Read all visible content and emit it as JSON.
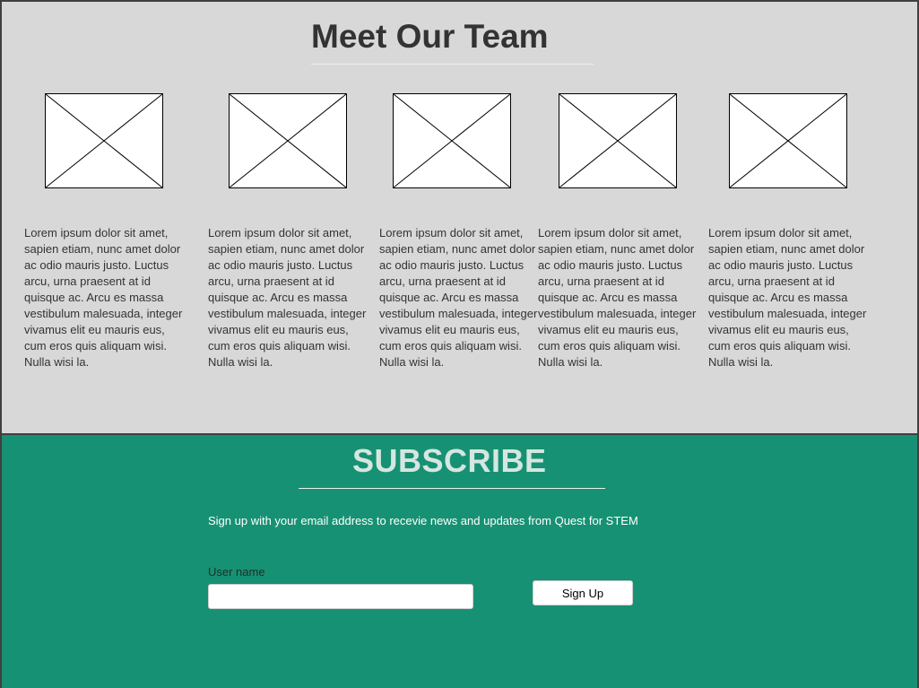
{
  "team": {
    "title": "Meet Our Team",
    "members": [
      {
        "photo_icon": "image-placeholder-icon",
        "bio": "Lorem ipsum dolor sit amet, sapien etiam, nunc amet dolor ac odio mauris justo. Luctus arcu, urna praesent at id quisque ac. Arcu es massa vestibulum malesuada, integer vivamus elit eu mauris eus, cum eros quis aliquam wisi. Nulla wisi la."
      },
      {
        "photo_icon": "image-placeholder-icon",
        "bio": "Lorem ipsum dolor sit amet, sapien etiam, nunc amet dolor ac odio mauris justo. Luctus arcu, urna praesent at id quisque ac. Arcu es massa vestibulum malesuada, integer vivamus elit eu mauris eus, cum eros quis aliquam wisi. Nulla wisi la."
      },
      {
        "photo_icon": "image-placeholder-icon",
        "bio": "Lorem ipsum dolor sit amet, sapien etiam, nunc amet dolor ac odio mauris justo. Luctus arcu, urna praesent at id quisque ac. Arcu es massa vestibulum malesuada, integer vivamus elit eu mauris eus, cum eros quis aliquam wisi. Nulla wisi la."
      },
      {
        "photo_icon": "image-placeholder-icon",
        "bio": "Lorem ipsum dolor sit amet, sapien etiam, nunc amet dolor ac odio mauris justo. Luctus arcu, urna praesent at id quisque ac. Arcu es massa vestibulum malesuada, integer vivamus elit eu mauris eus, cum eros quis aliquam wisi. Nulla wisi la."
      },
      {
        "photo_icon": "image-placeholder-icon",
        "bio": "Lorem ipsum dolor sit amet, sapien etiam, nunc amet dolor ac odio mauris justo. Luctus arcu, urna praesent at id quisque ac. Arcu es massa vestibulum malesuada, integer vivamus elit eu mauris eus, cum eros quis aliquam wisi. Nulla wisi la."
      }
    ]
  },
  "subscribe": {
    "title": "SUBSCRIBE",
    "description": "Sign up with your email address to recevie news and updates from Quest for STEM",
    "username_label": "User name",
    "username_value": "",
    "username_placeholder": "",
    "signup_label": "Sign Up"
  },
  "colors": {
    "team_background": "#d8d8d8",
    "subscribe_background": "#179173",
    "title_text": "#333333",
    "subscribe_title_text": "#d6e6e0"
  }
}
